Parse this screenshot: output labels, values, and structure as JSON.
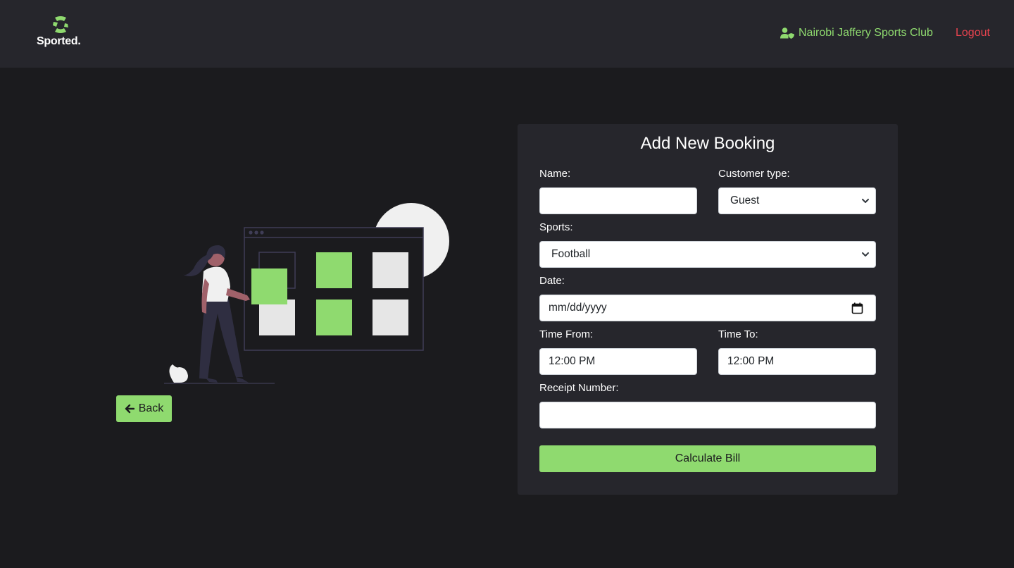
{
  "brand": {
    "name": "Sported."
  },
  "nav": {
    "club_name": "Nairobi Jaffery Sports Club",
    "logout_label": "Logout",
    "user_icon": "user-shield-icon"
  },
  "colors": {
    "accent": "#8fda6f",
    "danger": "#e8434f",
    "background": "#1b1b1e",
    "panel": "#26262c"
  },
  "back_button": {
    "label": "Back",
    "icon": "arrow-left-icon"
  },
  "form": {
    "title": "Add New Booking",
    "name": {
      "label": "Name:",
      "value": ""
    },
    "customer_type": {
      "label": "Customer type:",
      "value": "Guest"
    },
    "sports": {
      "label": "Sports:",
      "value": "Football"
    },
    "date": {
      "label": "Date:",
      "value": "mm/dd/yyyy"
    },
    "time_from": {
      "label": "Time From:",
      "value": "12:00 PM"
    },
    "time_to": {
      "label": "Time To:",
      "value": "12:00 PM"
    },
    "receipt_number": {
      "label": "Receipt Number:",
      "value": ""
    },
    "submit_label": "Calculate Bill"
  }
}
